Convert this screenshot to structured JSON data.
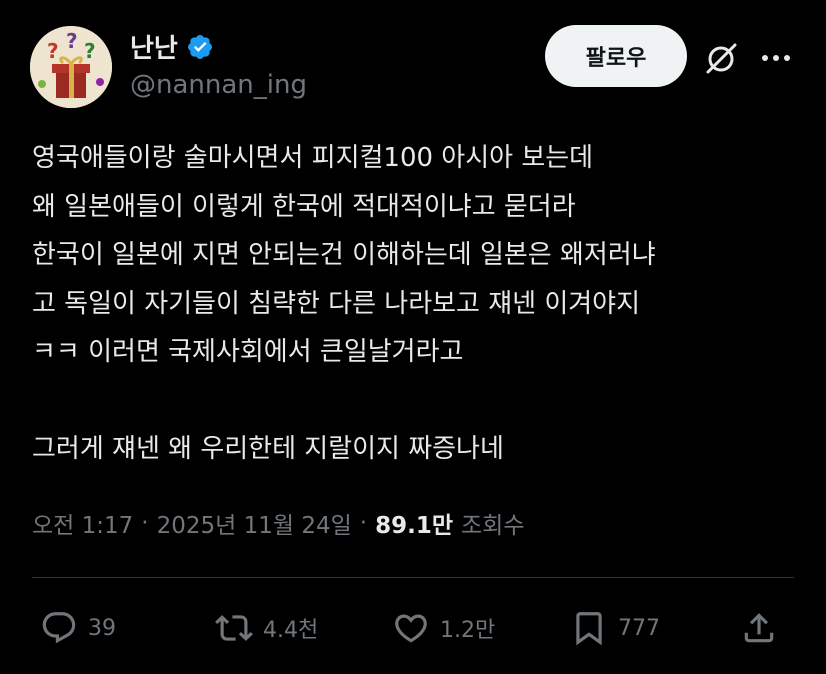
{
  "author": {
    "display_name": "난난",
    "handle": "@nannan_ing",
    "avatar_icon": "gift-box-question-avatar",
    "verified_icon": "verified-badge-icon",
    "verified_color": "#1d9bf0"
  },
  "header": {
    "follow_label": "팔로우",
    "grok_icon": "grok-icon",
    "more_icon": "more-icon"
  },
  "post": {
    "lines": [
      "영국애들이랑 술마시면서 피지컬100 아시아 보는데",
      "왜 일본애들이 이렇게 한국에 적대적이냐고 묻더라",
      "한국이 일본에 지면 안되는건 이해하는데 일본은 왜저러냐",
      "고 독일이 자기들이 침략한 다른 나라보고  쟤넨 이겨야지",
      "ㅋㅋ 이러면 국제사회에서 큰일날거라고",
      "",
      "그러게 쟤넨 왜 우리한테 지랄이지 짜증나네"
    ]
  },
  "meta": {
    "time": "오전 1:17",
    "separator": "·",
    "date": "2025년 11월 24일",
    "views_count": "89.1만",
    "views_label": "조회수"
  },
  "actions": {
    "reply": {
      "icon": "reply-icon",
      "count": "39"
    },
    "repost": {
      "icon": "repost-icon",
      "count": "4.4천"
    },
    "like": {
      "icon": "heart-icon",
      "count": "1.2만"
    },
    "bookmark": {
      "icon": "bookmark-icon",
      "count": "777"
    },
    "share": {
      "icon": "share-icon"
    }
  },
  "colors": {
    "background": "#000000",
    "text": "#e7e9ea",
    "secondary": "#71767b",
    "follow_bg": "#eff3f4",
    "divider": "#2f3336"
  }
}
